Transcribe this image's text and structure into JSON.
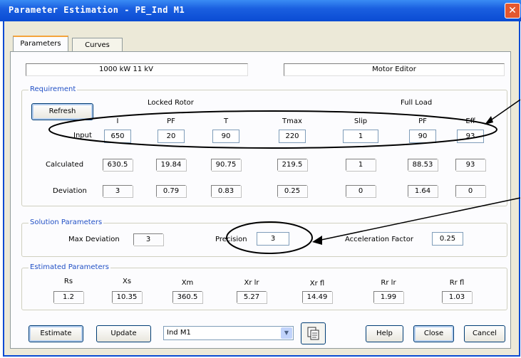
{
  "window": {
    "title": "Parameter Estimation - PE_Ind M1",
    "close_glyph": "✕"
  },
  "tabs": [
    {
      "label": "Parameters"
    },
    {
      "label": "Curves"
    }
  ],
  "info": {
    "rating": "1000 kW   11 kV",
    "editor": "Motor Editor"
  },
  "requirement": {
    "group_label": "Requirement",
    "refresh_label": "Refresh",
    "locked_rotor_header": "Locked Rotor",
    "full_load_header": "Full Load",
    "columns": [
      "I",
      "PF",
      "T",
      "Tmax",
      "Slip",
      "PF",
      "Eff"
    ],
    "row_labels": {
      "input": "Input",
      "calculated": "Calculated",
      "deviation": "Deviation"
    },
    "input": [
      "650",
      "20",
      "90",
      "220",
      "1",
      "90",
      "93"
    ],
    "calculated": [
      "630.5",
      "19.84",
      "90.75",
      "219.5",
      "1",
      "88.53",
      "93"
    ],
    "deviation": [
      "3",
      "0.79",
      "0.83",
      "0.25",
      "0",
      "1.64",
      "0"
    ]
  },
  "solution": {
    "group_label": "Solution Parameters",
    "max_deviation_label": "Max Deviation",
    "max_deviation": "3",
    "precision_label": "Precision",
    "precision": "3",
    "acceleration_label": "Acceleration Factor",
    "acceleration": "0.25"
  },
  "estimated": {
    "group_label": "Estimated Parameters",
    "columns": [
      "Rs",
      "Xs",
      "Xm",
      "Xr lr",
      "Xr fl",
      "Rr lr",
      "Rr fl"
    ],
    "values": [
      "1.2",
      "10.35",
      "360.5",
      "5.27",
      "14.49",
      "1.99",
      "1.03"
    ]
  },
  "footer": {
    "estimate": "Estimate",
    "update": "Update",
    "combo_value": "Ind M1",
    "help": "Help",
    "close": "Close",
    "cancel": "Cancel"
  },
  "colors": {
    "titlebar": "#0a4bd3",
    "group_label": "#2150c5",
    "annotation": "#000000"
  }
}
